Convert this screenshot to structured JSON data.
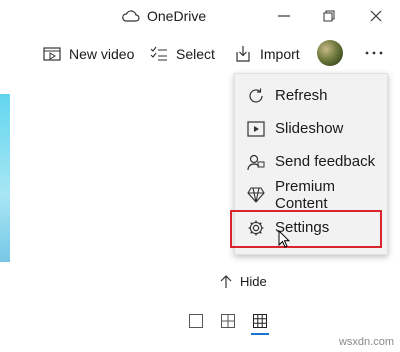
{
  "window": {
    "app_title": "OneDrive",
    "title_icon": "cloud-icon",
    "controls": [
      "minimize-icon",
      "restore-icon",
      "close-icon"
    ]
  },
  "toolbar": {
    "new_video_label": "New video",
    "select_label": "Select",
    "import_label": "Import",
    "more_icon": "ellipsis-icon"
  },
  "menu": {
    "items": [
      {
        "label": "Refresh",
        "icon": "refresh-icon"
      },
      {
        "label": "Slideshow",
        "icon": "slideshow-icon"
      },
      {
        "label": "Send feedback",
        "icon": "feedback-icon"
      },
      {
        "label": "Premium Content",
        "icon": "diamond-icon"
      },
      {
        "label": "Settings",
        "icon": "gear-icon"
      }
    ],
    "highlighted_item": "Settings",
    "highlight_color": "#d9262c"
  },
  "bottom": {
    "hide_label": "Hide",
    "view_modes": [
      "single-view-icon",
      "small-grid-icon",
      "large-grid-icon"
    ],
    "active_view": "large-grid-icon",
    "accent": "#1a73c8"
  },
  "watermark": "wsxdn.com"
}
